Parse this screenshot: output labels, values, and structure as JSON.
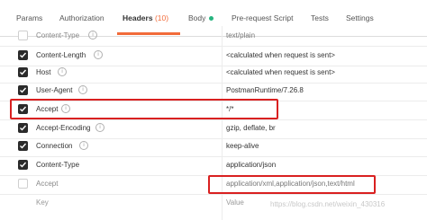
{
  "tabs": {
    "params": "Params",
    "authorization": "Authorization",
    "headers": "Headers",
    "headers_count": "(10)",
    "body": "Body",
    "prerequest": "Pre-request Script",
    "tests": "Tests",
    "settings": "Settings"
  },
  "rows": [
    {
      "key": "Content-Type",
      "value": "text/plain"
    },
    {
      "key": "Content-Length",
      "value": "<calculated when request is sent>"
    },
    {
      "key": "Host",
      "value": "<calculated when request is sent>"
    },
    {
      "key": "User-Agent",
      "value": "PostmanRuntime/7.26.8"
    },
    {
      "key": "Accept",
      "value": "*/*"
    },
    {
      "key": "Accept-Encoding",
      "value": "gzip, deflate, br"
    },
    {
      "key": "Connection",
      "value": "keep-alive"
    },
    {
      "key": "Content-Type",
      "value": "application/json"
    },
    {
      "key": "Accept",
      "value": "application/xml,application/json,text/html"
    }
  ],
  "new_row": {
    "key_placeholder": "Key",
    "value_placeholder": "Value"
  },
  "watermark": "https://blog.csdn.net/weixin_430316"
}
